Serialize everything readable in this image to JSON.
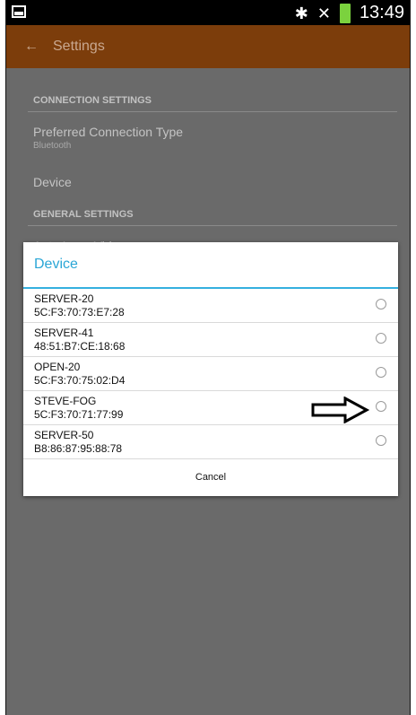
{
  "status_bar": {
    "time": "13:49",
    "icons": [
      "gallery-icon",
      "bluetooth-icon",
      "mute-icon",
      "battery-icon"
    ]
  },
  "action_bar": {
    "title": "Settings"
  },
  "settings": {
    "connection_header": "CONNECTION SETTINGS",
    "preferred_title": "Preferred Connection Type",
    "preferred_value": "Bluetooth",
    "device_title": "Device",
    "general_header": "GENERAL SETTINGS",
    "auto_loop_title": "Auto Loop Videos"
  },
  "dialog": {
    "title": "Device",
    "items": [
      {
        "name": "SERVER-20",
        "mac": "5C:F3:70:73:E7:28"
      },
      {
        "name": "SERVER-41",
        "mac": "48:51:B7:CE:18:68"
      },
      {
        "name": "OPEN-20",
        "mac": "5C:F3:70:75:02:D4"
      },
      {
        "name": "STEVE-FOG",
        "mac": "5C:F3:70:71:77:99"
      },
      {
        "name": "SERVER-50",
        "mac": "B8:86:87:95:88:78"
      }
    ],
    "cancel_label": "Cancel"
  },
  "colors": {
    "action_bar": "#7c3d0b",
    "accent": "#35b0df",
    "overlay": "#6a6a6a"
  }
}
